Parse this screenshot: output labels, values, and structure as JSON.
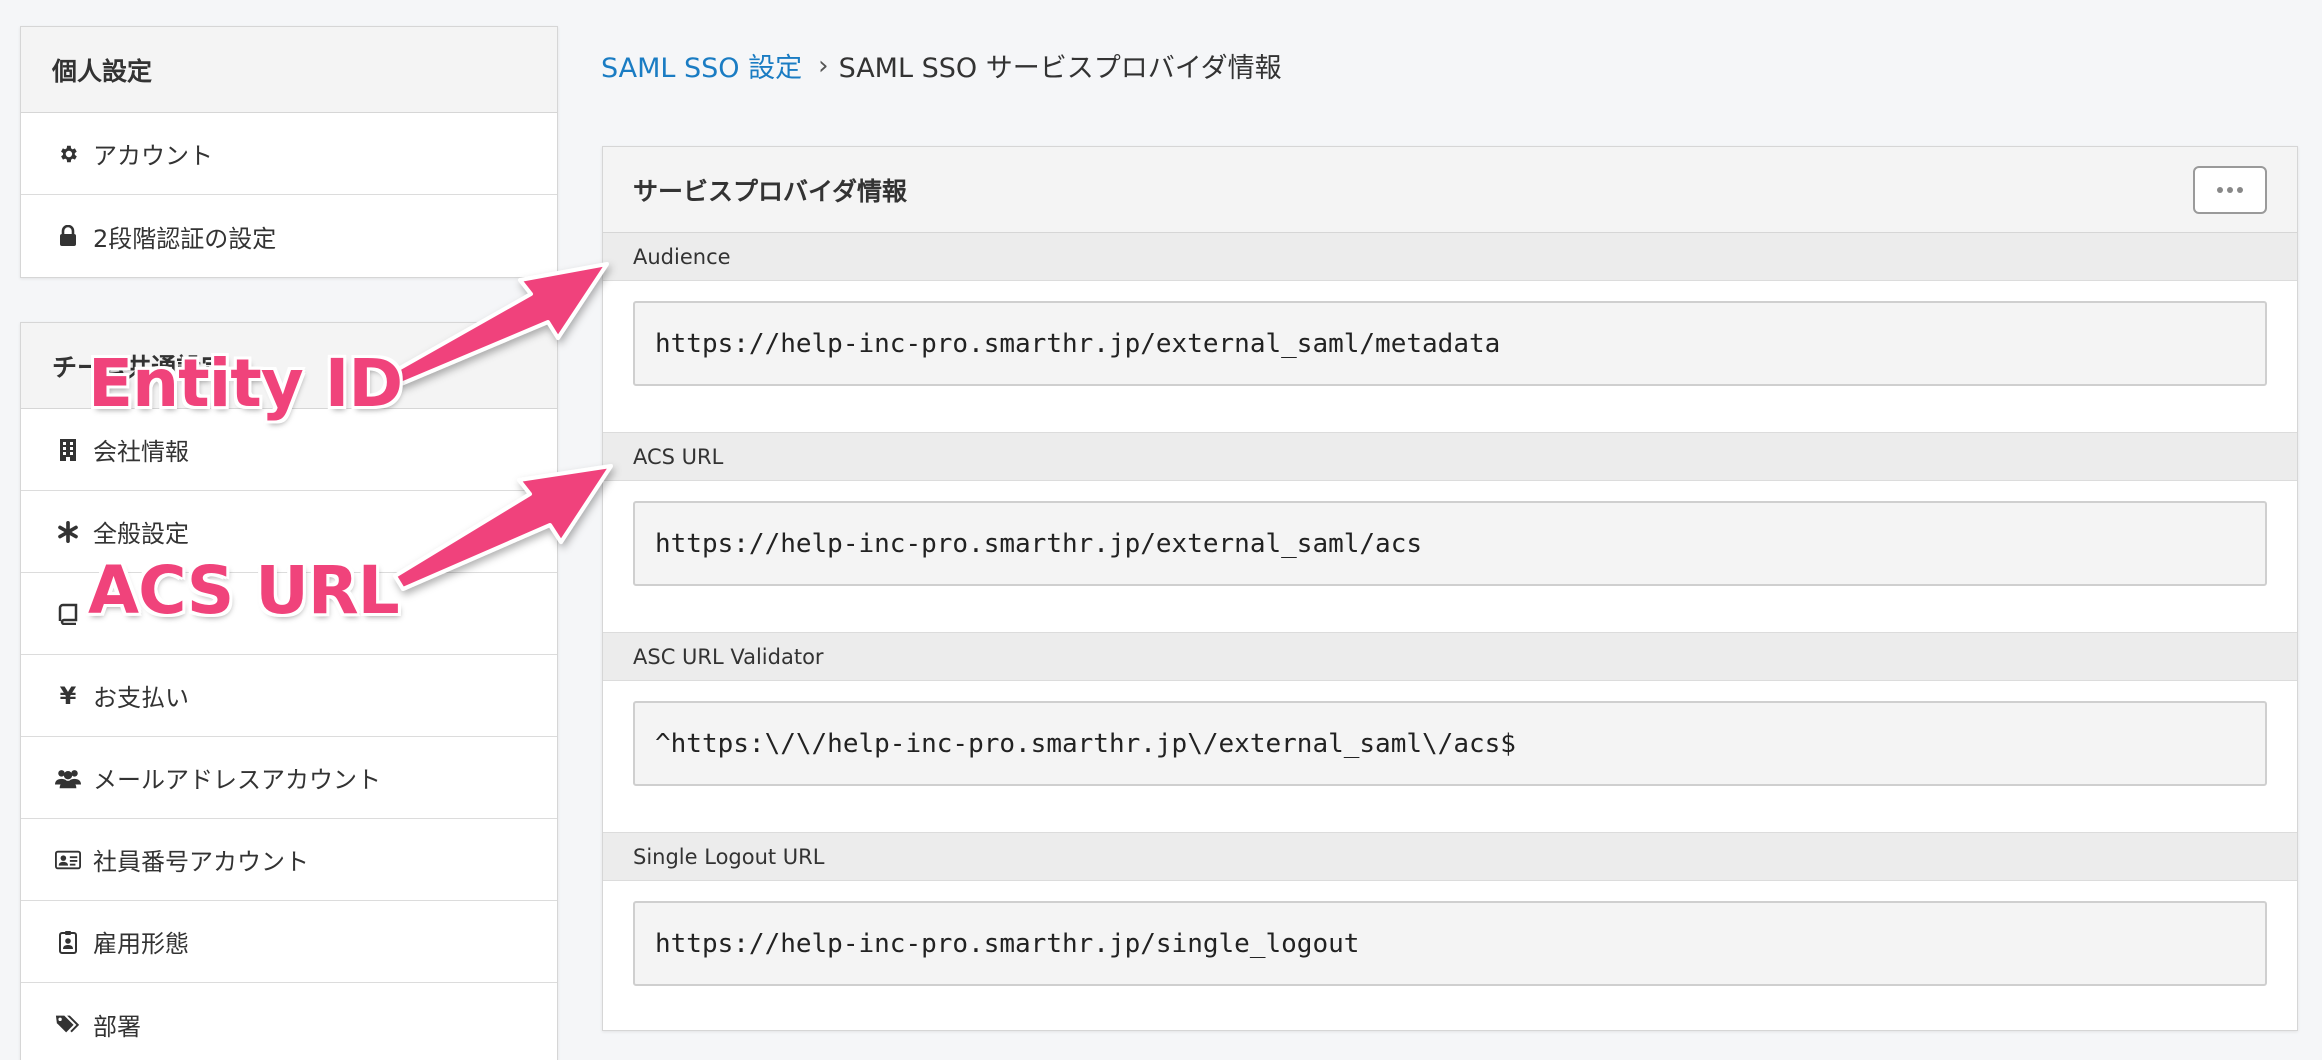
{
  "sidebar": {
    "personal": {
      "title": "個人設定",
      "items": [
        {
          "label": "アカウント",
          "icon": "gear-icon"
        },
        {
          "label": "2段階認証の設定",
          "icon": "lock-icon"
        }
      ]
    },
    "team": {
      "title": "チーム共通設定",
      "items": [
        {
          "label": "会社情報",
          "icon": "building-icon"
        },
        {
          "label": "全般設定",
          "icon": "asterisk-icon"
        },
        {
          "label": "",
          "icon": "book-icon"
        },
        {
          "label": "お支払い",
          "icon": "yen-icon"
        },
        {
          "label": "メールアドレスアカウント",
          "icon": "users-icon"
        },
        {
          "label": "社員番号アカウント",
          "icon": "id-card-icon"
        },
        {
          "label": "雇用形態",
          "icon": "badge-icon"
        },
        {
          "label": "部署",
          "icon": "tags-icon"
        }
      ]
    }
  },
  "breadcrumb": {
    "parent": "SAML SSO 設定",
    "separator": "›",
    "current": "SAML SSO サービスプロバイダ情報"
  },
  "card": {
    "title": "サービスプロバイダ情報",
    "fields": [
      {
        "label": "Audience",
        "value": "https://help-inc-pro.smarthr.jp/external_saml/metadata"
      },
      {
        "label": "ACS URL",
        "value": "https://help-inc-pro.smarthr.jp/external_saml/acs"
      },
      {
        "label": "ASC URL Validator",
        "value": "^https:\\/\\/help-inc-pro.smarthr.jp\\/external_saml\\/acs$"
      },
      {
        "label": "Single Logout URL",
        "value": "https://help-inc-pro.smarthr.jp/single_logout"
      }
    ]
  },
  "annotations": {
    "entity_id": "Entity ID",
    "acs_url": "ACS URL",
    "color": "#f0437b"
  },
  "colors": {
    "link": "#1a7cc3",
    "background": "#f5f6f8",
    "header_bg": "#f4f4f4",
    "label_bg": "#ececec"
  }
}
